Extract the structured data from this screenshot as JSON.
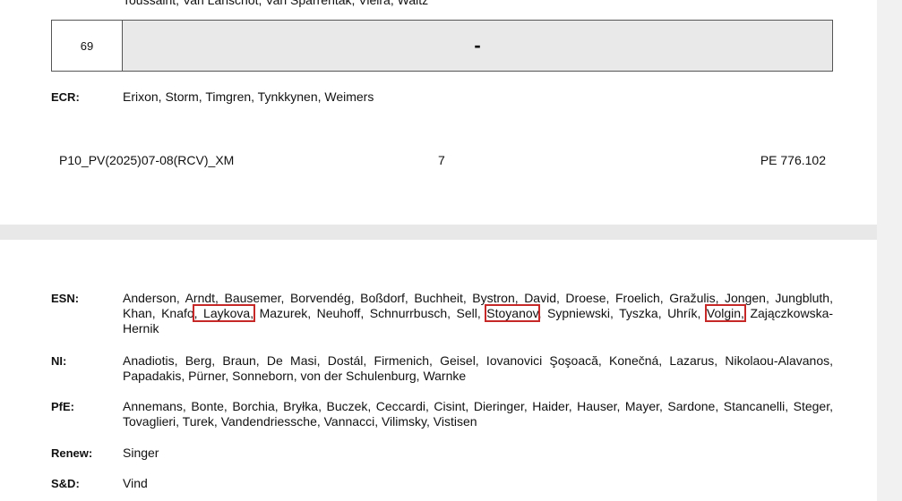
{
  "page1": {
    "cut_line": "Toussaint, Van Lanschot, Van Sparrentak, Vieira, Waitz",
    "vote": {
      "number": "69",
      "result": "-"
    },
    "ecr": {
      "label": "ECR:",
      "names": "Erixon, Storm, Timgren, Tynkkynen, Weimers"
    },
    "footer": {
      "ref": "P10_PV(2025)07-08(RCV)_XM",
      "page": "7",
      "pe": "PE 776.102"
    }
  },
  "page2": {
    "esn": {
      "label": "ESN:",
      "part1": "Anderson, Arndt, Bausemer, Borvendég, Boßdorf, Buchheit, Bystron, David, Droese, Froelich, Gražulis, Jongen, Jungbluth, Khan, Knafo",
      "hl1": ", Laykova,",
      "part2": " Mazurek, Neuhoff, Schnurrbusch, Sell, ",
      "hl2": "Stoyanov",
      "part3": ", Sypniewski, Tyszka, Uhrík, ",
      "hl3": "Volgin,",
      "part4": " Zajączkowska-Hernik"
    },
    "ni": {
      "label": "NI:",
      "names": "Anadiotis, Berg, Braun, De Masi, Dostál, Firmenich, Geisel, Iovanovici Şoşoacă, Konečná, Lazarus, Nikolaou-Alavanos, Papadakis, Pürner, Sonneborn, von der Schulenburg, Warnke"
    },
    "pfe": {
      "label": "PfE:",
      "names": "Annemans, Bonte, Borchia, Bryłka, Buczek, Ceccardi, Cisint, Dieringer, Haider, Hauser, Mayer, Sardone, Stancanelli, Steger, Tovaglieri, Turek, Vandendriessche, Vannacci, Vilimsky, Vistisen"
    },
    "renew": {
      "label": "Renew:",
      "names": "Singer"
    },
    "sd": {
      "label": "S&D:",
      "names": "Vind"
    }
  },
  "colors": {
    "highlight": "#c62828",
    "gap": "#e8e8e8",
    "table_fill": "#e9e9e9"
  }
}
